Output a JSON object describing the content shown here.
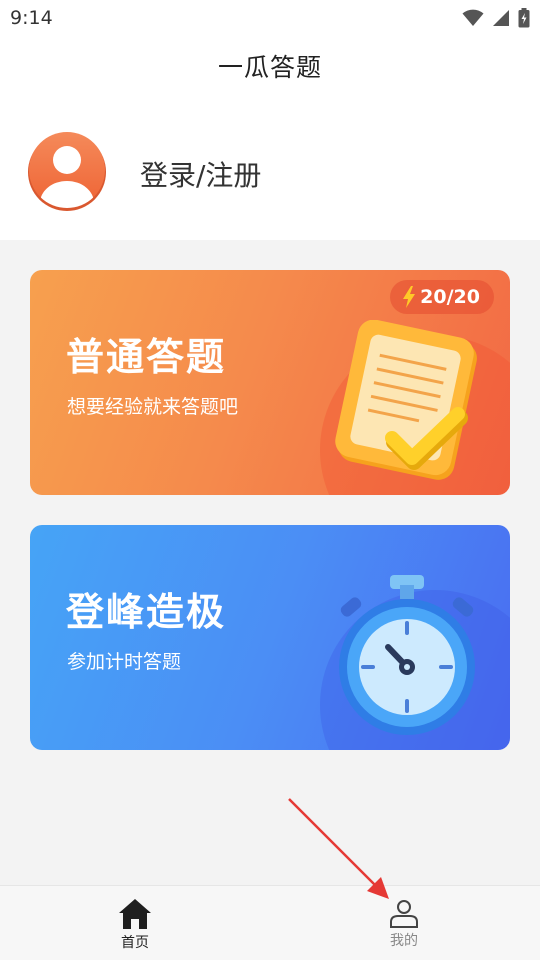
{
  "status_bar": {
    "time": "9:14",
    "icons": [
      "wifi-icon",
      "signal-icon",
      "battery-icon"
    ]
  },
  "header": {
    "title": "一瓜答题"
  },
  "profile": {
    "login_label": "登录/注册",
    "avatar_icon": "user-avatar-icon",
    "avatar_color": "#f0703f"
  },
  "cards": [
    {
      "title": "普通答题",
      "subtitle": "想要经验就来答题吧",
      "badge": "20/20",
      "badge_icon": "lightning-icon",
      "illustration": "notepad-checkmark-icon",
      "gradient": [
        "#f7a04e",
        "#f26844"
      ]
    },
    {
      "title": "登峰造极",
      "subtitle": "参加计时答题",
      "illustration": "stopwatch-icon",
      "gradient": [
        "#46a4f6",
        "#4a6cf1"
      ]
    }
  ],
  "bottom_nav": {
    "items": [
      {
        "label": "首页",
        "icon": "home-icon",
        "active": true
      },
      {
        "label": "我的",
        "icon": "user-icon",
        "active": false
      }
    ]
  },
  "annotation": {
    "type": "arrow",
    "color": "#e53935",
    "target": "bottom-nav-mine"
  }
}
